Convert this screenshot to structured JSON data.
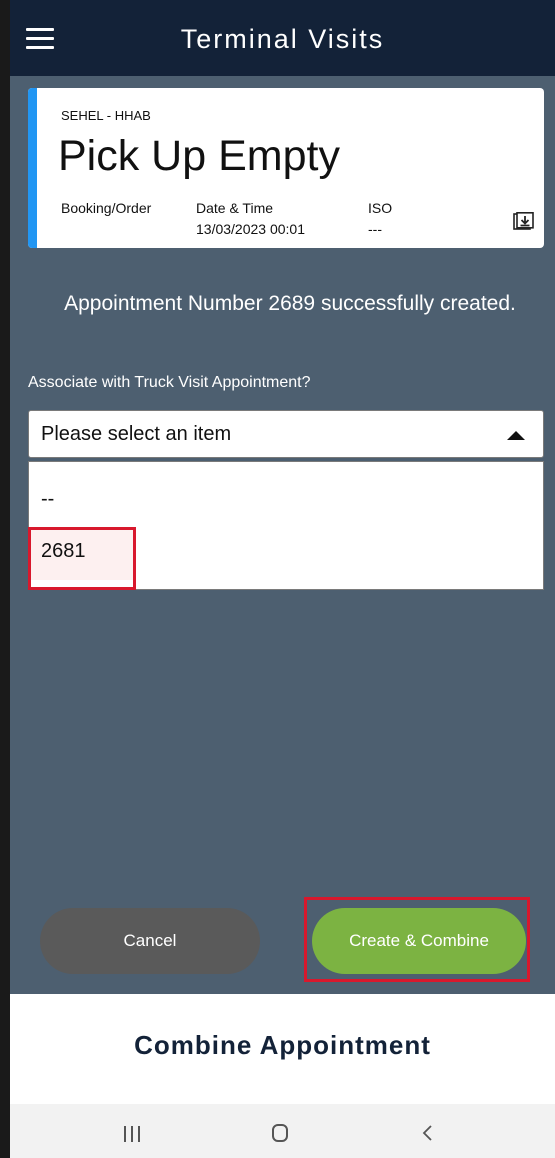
{
  "header": {
    "title": "Terminal Visits",
    "menu_icon": "hamburger-menu-icon"
  },
  "card": {
    "subtitle": "SEHEL - HHAB",
    "title": "Pick Up Empty",
    "accent_color": "#2196f3",
    "columns": [
      {
        "label": "Booking/Order",
        "value": ""
      },
      {
        "label": "Date & Time",
        "value": "13/03/2023 00:01"
      },
      {
        "label": "ISO",
        "value": "---"
      }
    ],
    "action_icon": "document-download-icon"
  },
  "main": {
    "success_message": "Appointment Number 2689 successfully created.",
    "associate_label": "Associate with Truck Visit Appointment?",
    "select": {
      "placeholder": "Please select an item",
      "options": [
        "--",
        "2681"
      ],
      "highlighted_option": "2681"
    }
  },
  "buttons": {
    "cancel_label": "Cancel",
    "create_label": "Create & Combine",
    "create_color": "#7cb342",
    "cancel_color": "#5a5a5a"
  },
  "sheet": {
    "title": "Combine Appointment"
  },
  "navbar": {
    "icons": [
      "recent-apps-icon",
      "home-icon",
      "back-icon"
    ]
  },
  "colors": {
    "appbar": "#132238",
    "background": "#4d5f70",
    "highlight": "#d8182d"
  }
}
